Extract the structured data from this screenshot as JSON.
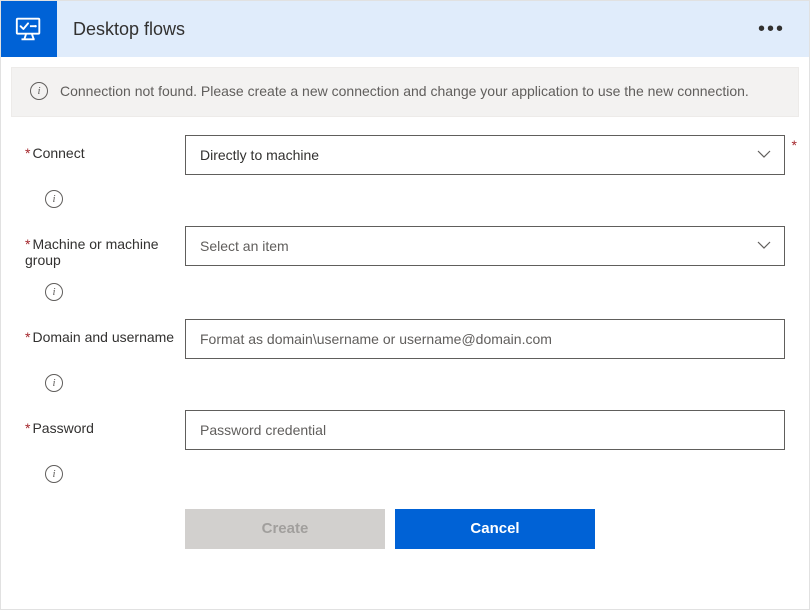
{
  "header": {
    "title": "Desktop flows"
  },
  "alert": {
    "text": "Connection not found. Please create a new connection and change your application to use the new connection."
  },
  "form": {
    "connect": {
      "label": "Connect",
      "value": "Directly to machine"
    },
    "machine": {
      "label": "Machine or machine group",
      "placeholder": "Select an item"
    },
    "domain_user": {
      "label": "Domain and username",
      "placeholder": "Format as domain\\username or username@domain.com"
    },
    "password": {
      "label": "Password",
      "placeholder": "Password credential"
    }
  },
  "buttons": {
    "create": "Create",
    "cancel": "Cancel"
  }
}
